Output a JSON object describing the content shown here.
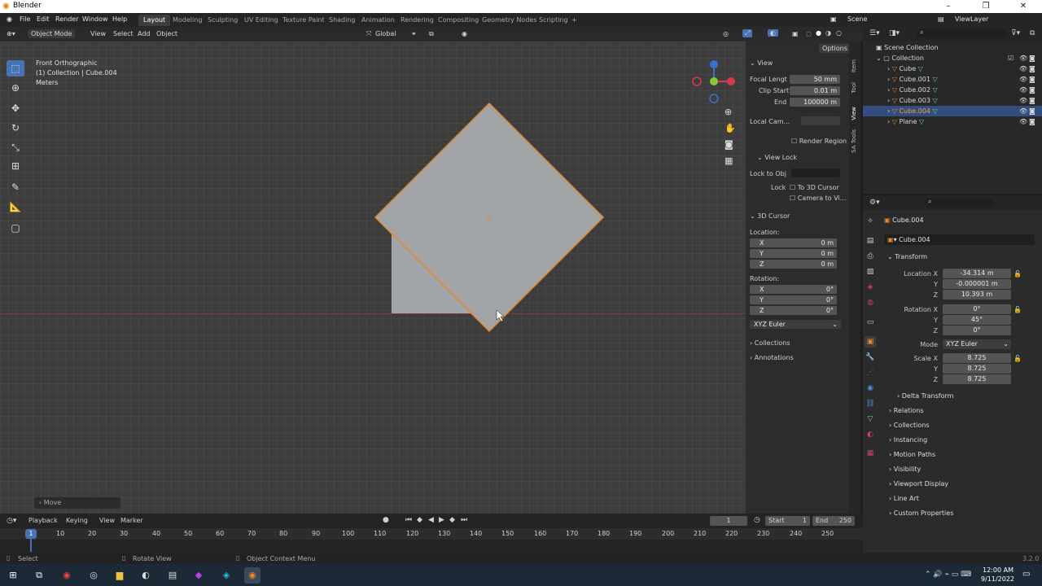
{
  "window": {
    "title": "Blender",
    "minimize": "–",
    "maximize": "❐",
    "close": "✕"
  },
  "menu": [
    "File",
    "Edit",
    "Render",
    "Window",
    "Help"
  ],
  "workspaces": [
    "Layout",
    "Modeling",
    "Sculpting",
    "UV Editing",
    "Texture Paint",
    "Shading",
    "Animation",
    "Rendering",
    "Compositing",
    "Geometry Nodes",
    "Scripting",
    "+"
  ],
  "scene": {
    "name": "Scene",
    "viewlayer": "ViewLayer"
  },
  "viewport_header": {
    "mode": "Object Mode",
    "menus": [
      "View",
      "Select",
      "Add",
      "Object"
    ],
    "orientation": "Global",
    "options": "Options"
  },
  "viewport_info": {
    "view": "Front Orthographic",
    "collection": "(1) Collection | Cube.004",
    "units": "Meters"
  },
  "last_op": "Move",
  "npanel": {
    "view_header": "View",
    "focal_label": "Focal Lengt",
    "focal_value": "50 mm",
    "clip_start_label": "Clip Start",
    "clip_start_value": "0.01 m",
    "end_label": "End",
    "end_value": "100000 m",
    "local_cam_label": "Local Cam...",
    "render_region": "Render Region",
    "view_lock_header": "View Lock",
    "lock_obj_label": "Lock to Obj",
    "lock_label": "Lock",
    "to_cursor": "To 3D Cursor",
    "camera_to_view": "Camera to Vi...",
    "cursor_header": "3D Cursor",
    "location_label": "Location:",
    "loc": [
      {
        "axis": "X",
        "value": "0 m"
      },
      {
        "axis": "Y",
        "value": "0 m"
      },
      {
        "axis": "Z",
        "value": "0 m"
      }
    ],
    "rotation_label": "Rotation:",
    "rot": [
      {
        "axis": "X",
        "value": "0°"
      },
      {
        "axis": "Y",
        "value": "0°"
      },
      {
        "axis": "Z",
        "value": "0°"
      }
    ],
    "euler": "XYZ Euler",
    "collections": "Collections",
    "annotations": "Annotations",
    "tabs": [
      "Item",
      "Tool",
      "View",
      "SA Tools"
    ]
  },
  "outliner": {
    "scene_collection": "Scene Collection",
    "collection": "Collection",
    "objects": [
      "Cube",
      "Cube.001",
      "Cube.002",
      "Cube.003",
      "Cube.004",
      "Plane"
    ],
    "selected_index": 4
  },
  "properties": {
    "object_name": "Cube.004",
    "data_name": "Cube.004",
    "transform_header": "Transform",
    "location_x_label": "Location X",
    "location": [
      "-34.314 m",
      "-0.000001 m",
      "10.393 m"
    ],
    "rotation_x_label": "Rotation X",
    "rotation": [
      "0°",
      "45°",
      "0°"
    ],
    "mode_label": "Mode",
    "mode_value": "XYZ Euler",
    "scale_x_label": "Scale X",
    "scale": [
      "8.725",
      "8.725",
      "8.725"
    ],
    "y_label": "Y",
    "z_label": "Z",
    "sections": [
      "Delta Transform",
      "Relations",
      "Collections",
      "Instancing",
      "Motion Paths",
      "Visibility",
      "Viewport Display",
      "Line Art",
      "Custom Properties"
    ]
  },
  "timeline": {
    "menus": [
      "Playback",
      "Keying",
      "View",
      "Marker"
    ],
    "current_frame": "1",
    "start_label": "Start",
    "start": "1",
    "end_label": "End",
    "end": "250",
    "ruler": [
      "10",
      "20",
      "30",
      "40",
      "50",
      "60",
      "70",
      "80",
      "90",
      "100",
      "110",
      "120",
      "130",
      "140",
      "150",
      "160",
      "170",
      "180",
      "190",
      "200",
      "210",
      "220",
      "230",
      "240",
      "250"
    ],
    "playhead": "1"
  },
  "statusbar": {
    "select": "Select",
    "rotate": "Rotate View",
    "context": "Object Context Menu",
    "version": "3.2.0"
  },
  "taskbar": {
    "time": "12:00 AM",
    "date": "9/11/2022"
  }
}
